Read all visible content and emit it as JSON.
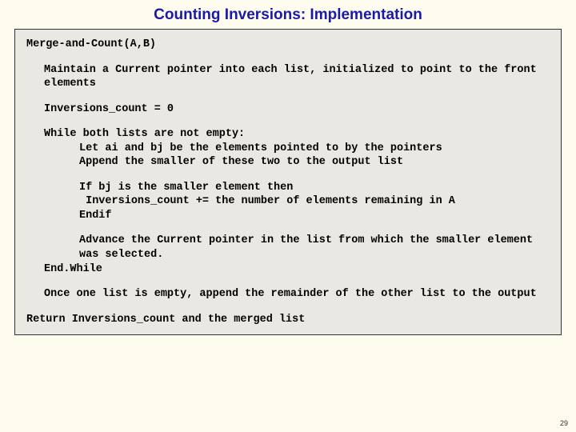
{
  "title": "Counting Inversions:  Implementation",
  "page_number": "29",
  "code": {
    "fn_sig": "Merge-and-Count(A,B)",
    "maintain": "Maintain a Current pointer into each list, initialized to point to the front elements",
    "init": "Inversions_count = 0",
    "while_hdr": "While both lists are not empty:",
    "let_line": "Let ai and bj be the elements pointed to by the pointers",
    "append_line": "Append the smaller of these two to the output list",
    "if_line": "If bj is the smaller element then",
    "inc_line": " Inversions_count += the number of elements remaining in A",
    "endif": "Endif",
    "advance": "Advance the Current pointer in the list from which the smaller element was selected.",
    "endwhile": "End.While",
    "once_empty": "Once one list is empty, append the remainder of the other list to the output",
    "return_line": "Return Inversions_count and the merged list"
  }
}
